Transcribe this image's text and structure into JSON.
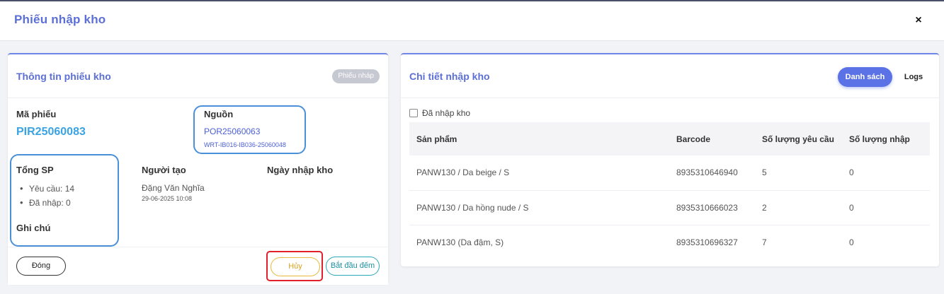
{
  "modal": {
    "title": "Phiếu nhập kho",
    "close": "×"
  },
  "info": {
    "title": "Thông tin phiếu kho",
    "status_badge": "Phiếu nháp",
    "code_label": "Mã phiếu",
    "code_value": "PIR25060083",
    "source_label": "Nguồn",
    "source_code": "POR25060063",
    "source_ref": "WRT-IB016-IB036-25060048",
    "total_label": "Tổng SP",
    "requested": "Yêu cầu: 14",
    "received": "Đã nhập: 0",
    "creator_label": "Người tạo",
    "creator_name": "Đặng Văn Nghĩa",
    "created_at": "29-06-2025 10:08",
    "date_label": "Ngày nhập kho",
    "note_label": "Ghi chú"
  },
  "actions": {
    "close": "Đóng",
    "cancel": "Hủy",
    "start": "Bắt đầu đếm"
  },
  "detail": {
    "title": "Chi tiết nhập kho",
    "tab_list": "Danh sách",
    "tab_logs": "Logs",
    "filter_label": "Đã nhập kho",
    "columns": [
      "Sản phẩm",
      "Barcode",
      "Số lượng yêu cầu",
      "Số lượng nhập"
    ],
    "rows": [
      [
        "PANW130 / Da beige / S",
        "8935310646940",
        "5",
        "0"
      ],
      [
        "PANW130 / Da hồng nude / S",
        "8935310666023",
        "2",
        "0"
      ],
      [
        "PANW130 (Da đậm, S)",
        "8935310696327",
        "7",
        "0"
      ]
    ]
  },
  "colors": {
    "accent": "#5b72e6",
    "title": "#5b6fd6",
    "code": "#3aa3e3",
    "cancel": "#e8b93a",
    "start": "#2aa8b8",
    "highlight_red": "#e0202a",
    "highlight_blue": "#4a90d9"
  }
}
